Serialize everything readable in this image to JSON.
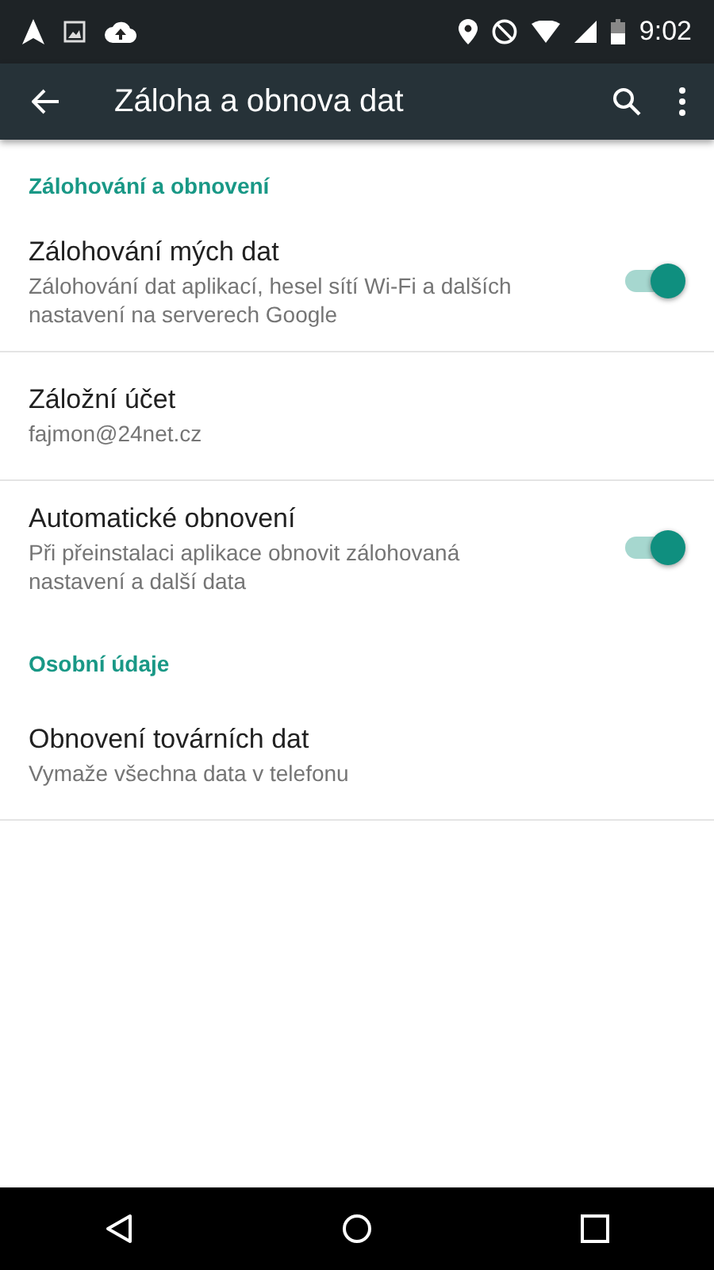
{
  "status_bar": {
    "time": "9:02"
  },
  "toolbar": {
    "title": "Záloha a obnova dat"
  },
  "sections": [
    {
      "header": "Zálohování a obnovení",
      "items": [
        {
          "kind": "toggle",
          "title": "Zálohování mých dat",
          "summary": "Zálohování dat aplikací, hesel sítí Wi-Fi a dalších nastavení na serverech Google",
          "on": true
        },
        {
          "kind": "plain",
          "title": "Záložní účet",
          "summary": "fajmon@24net.cz"
        },
        {
          "kind": "toggle",
          "title": "Automatické obnovení",
          "summary": "Při přeinstalaci aplikace obnovit zálohovaná nastavení a další data",
          "on": true
        }
      ]
    },
    {
      "header": "Osobní údaje",
      "items": [
        {
          "kind": "plain",
          "title": "Obnovení továrních dat",
          "summary": "Vymaže všechna data v telefonu"
        }
      ]
    }
  ]
}
